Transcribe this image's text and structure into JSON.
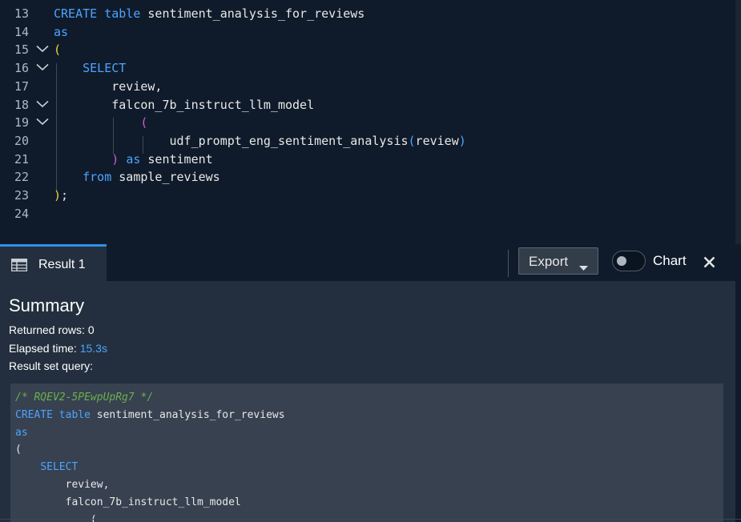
{
  "editor": {
    "lines": [
      {
        "num": "13",
        "tokens": [
          {
            "t": "CREATE",
            "c": "kw"
          },
          {
            "t": " "
          },
          {
            "t": "table",
            "c": "kw"
          },
          {
            "t": " sentiment_analysis_for_reviews"
          }
        ]
      },
      {
        "num": "14",
        "tokens": [
          {
            "t": "as",
            "c": "kw"
          }
        ]
      },
      {
        "num": "15",
        "fold": true,
        "tokens": [
          {
            "t": "(",
            "c": "py"
          }
        ]
      },
      {
        "num": "16",
        "fold": true,
        "tokens": [
          {
            "t": "    "
          },
          {
            "t": "SELECT",
            "c": "kw"
          }
        ]
      },
      {
        "num": "17",
        "tokens": [
          {
            "t": "        review,"
          }
        ]
      },
      {
        "num": "18",
        "fold": true,
        "tokens": [
          {
            "t": "        falcon_7b_instruct_llm_model"
          }
        ]
      },
      {
        "num": "19",
        "fold": true,
        "tokens": [
          {
            "t": "            "
          },
          {
            "t": "(",
            "c": "pm"
          }
        ]
      },
      {
        "num": "20",
        "tokens": [
          {
            "t": "                udf_prompt_eng_sentiment_analysis"
          },
          {
            "t": "(",
            "c": "pb"
          },
          {
            "t": "review"
          },
          {
            "t": ")",
            "c": "pb"
          }
        ]
      },
      {
        "num": "21",
        "tokens": [
          {
            "t": "        "
          },
          {
            "t": ")",
            "c": "pm"
          },
          {
            "t": " "
          },
          {
            "t": "as",
            "c": "kw"
          },
          {
            "t": " sentiment"
          }
        ]
      },
      {
        "num": "22",
        "tokens": [
          {
            "t": "    "
          },
          {
            "t": "from",
            "c": "kw"
          },
          {
            "t": " sample_reviews"
          }
        ]
      },
      {
        "num": "23",
        "tokens": [
          {
            "t": ")",
            "c": "py"
          },
          {
            "t": ";"
          }
        ]
      },
      {
        "num": "24",
        "tokens": []
      }
    ]
  },
  "results": {
    "tab_label": "Result 1",
    "export_label": "Export",
    "chart_label": "Chart",
    "chart_toggle_on": false
  },
  "summary": {
    "title": "Summary",
    "returned_rows_label": "Returned rows: ",
    "returned_rows_value": "0",
    "elapsed_label": "Elapsed time: ",
    "elapsed_value": "15.3s",
    "query_label": "Result set query:"
  },
  "query": {
    "lines": [
      [
        {
          "t": "/* RQEV2-5PEwpUpRg7 */",
          "c": "cm"
        }
      ],
      [
        {
          "t": "CREATE",
          "c": "kw"
        },
        {
          "t": " "
        },
        {
          "t": "table",
          "c": "kw"
        },
        {
          "t": " sentiment_analysis_for_reviews"
        }
      ],
      [
        {
          "t": "as",
          "c": "kw"
        }
      ],
      [
        {
          "t": "("
        }
      ],
      [
        {
          "t": "    "
        },
        {
          "t": "SELECT",
          "c": "kw"
        }
      ],
      [
        {
          "t": "        review,"
        }
      ],
      [
        {
          "t": "        falcon_7b_instruct_llm_model"
        }
      ],
      [
        {
          "t": "            ("
        }
      ]
    ]
  },
  "colors": {
    "keyword": "#4ea3ff",
    "paren_magenta": "#d05cd8",
    "paren_yellow": "#f6d146",
    "comment": "#6ab04c",
    "accent": "#2f8fe8"
  }
}
